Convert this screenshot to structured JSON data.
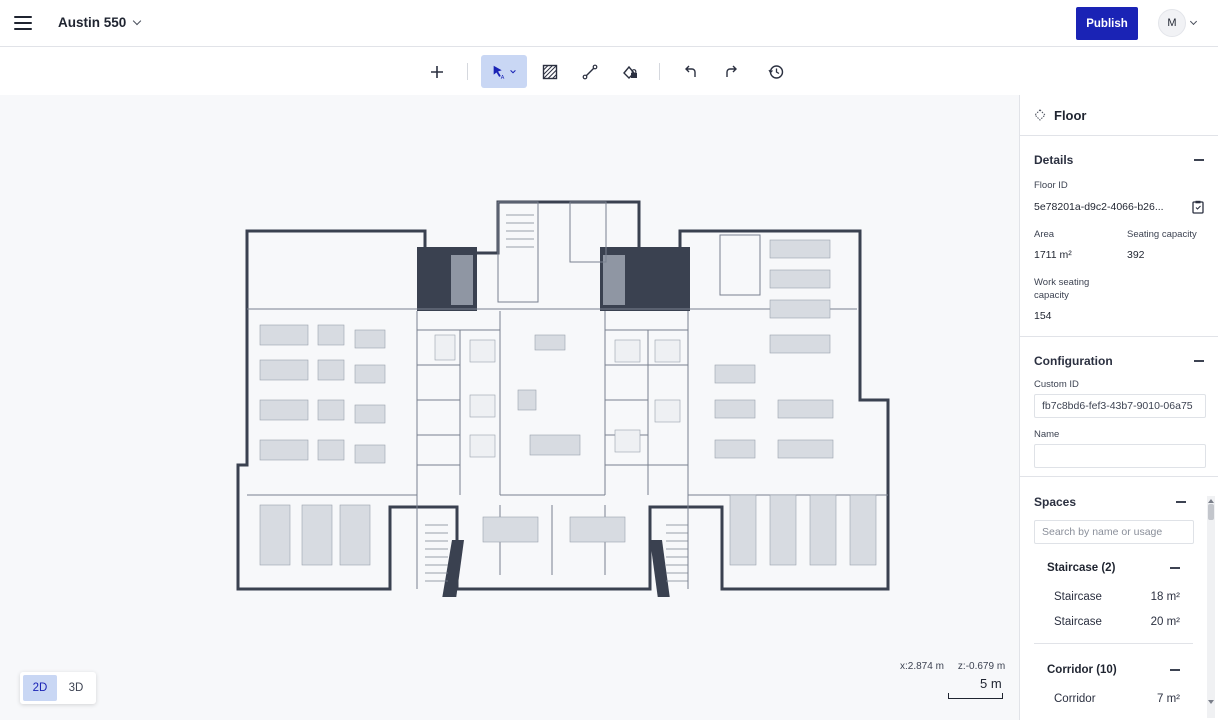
{
  "header": {
    "menu_icon": "hamburger-menu-icon",
    "building_name": "Austin 550",
    "publish_label": "Publish",
    "avatar_initial": "M"
  },
  "toolbar": {
    "tools": [
      "add-icon",
      "select-cursor-icon",
      "area-hatch-icon",
      "line-draw-icon",
      "fill-lock-icon",
      "undo-icon",
      "redo-icon",
      "history-icon"
    ]
  },
  "canvas": {
    "view_2d": "2D",
    "view_3d": "3D",
    "active_view": "2D",
    "coord_x": "x:2.874 m",
    "coord_z": "z:-0.679 m",
    "scale_label": "5 m"
  },
  "panel": {
    "title": "Floor",
    "details": {
      "title": "Details",
      "floor_id_label": "Floor ID",
      "floor_id_value": "5e78201a-d9c2-4066-b26...",
      "area_label": "Area",
      "area_value": "1711 m²",
      "seating_label": "Seating capacity",
      "seating_value": "392",
      "work_seating_label": "Work seating capacity",
      "work_seating_value": "154"
    },
    "configuration": {
      "title": "Configuration",
      "custom_id_label": "Custom ID",
      "custom_id_value": "fb7c8bd6-fef3-43b7-9010-06a75",
      "name_label": "Name",
      "name_value": ""
    },
    "spaces": {
      "title": "Spaces",
      "search_placeholder": "Search by name or usage",
      "groups": [
        {
          "title": "Staircase (2)",
          "items": [
            {
              "name": "Staircase",
              "area": "18 m²"
            },
            {
              "name": "Staircase",
              "area": "20 m²"
            }
          ]
        },
        {
          "title": "Corridor (10)",
          "items": [
            {
              "name": "Corridor",
              "area": "7 m²"
            }
          ]
        }
      ]
    }
  },
  "colors": {
    "accent": "#1a23b5",
    "active_tool_bg": "#c9d7f4",
    "wall": "#3a4150"
  }
}
